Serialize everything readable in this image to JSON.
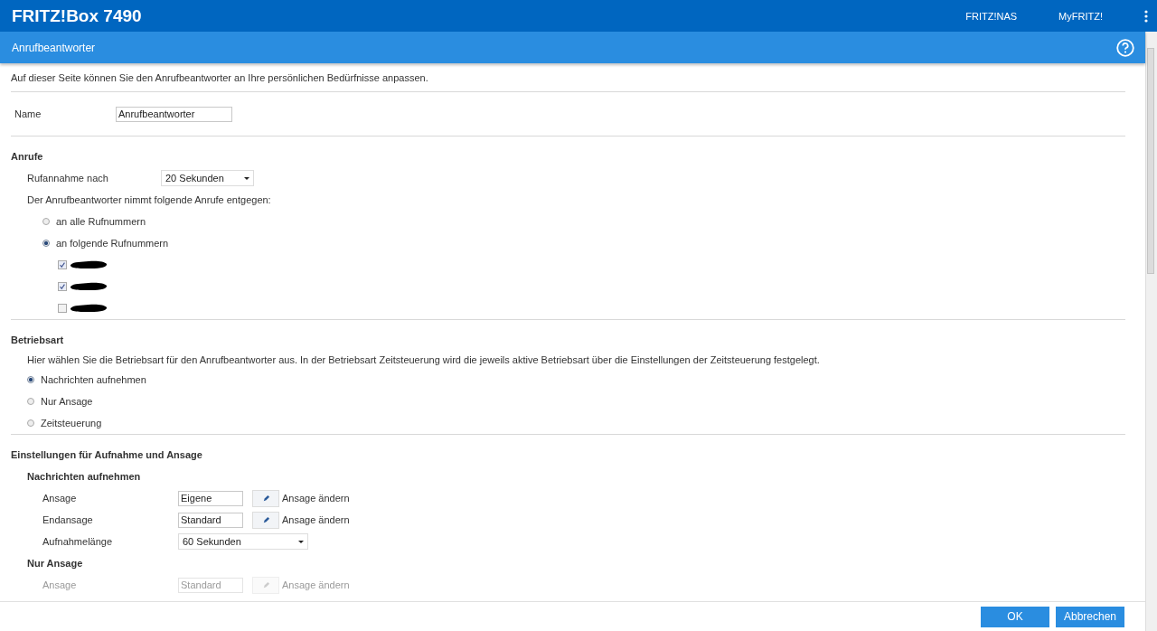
{
  "header": {
    "title": "FRITZ!Box 7490",
    "links": [
      "FRITZ!NAS",
      "MyFRITZ!"
    ]
  },
  "page": {
    "title": "Anrufbeantworter"
  },
  "intro": "Auf dieser Seite können Sie den Anrufbeantworter an Ihre persönlichen Bedürfnisse anpassen.",
  "name": {
    "label": "Name",
    "value": "Anrufbeantworter"
  },
  "calls": {
    "heading": "Anrufe",
    "pickup": {
      "label": "Rufannahme nach",
      "value": "20 Sekunden"
    },
    "prompt": "Der Anrufbeantworter nimmt folgende Anrufe entgegen:",
    "options": [
      {
        "label": "an alle Rufnummern",
        "selected": false
      },
      {
        "label": "an folgende Rufnummern",
        "selected": true
      }
    ],
    "numbers": [
      {
        "checked": true
      },
      {
        "checked": true
      },
      {
        "checked": false
      }
    ]
  },
  "mode": {
    "heading": "Betriebsart",
    "description": "Hier wählen Sie die Betriebsart für den Anrufbeantworter aus. In der Betriebsart Zeitsteuerung wird die jeweils aktive Betriebsart über die Einstellungen der Zeitsteuerung festgelegt.",
    "options": [
      {
        "label": "Nachrichten aufnehmen",
        "selected": true
      },
      {
        "label": "Nur Ansage",
        "selected": false
      },
      {
        "label": "Zeitsteuerung",
        "selected": false
      }
    ]
  },
  "settings": {
    "heading": "Einstellungen für Aufnahme und Ansage",
    "groups": [
      {
        "heading": "Nachrichten aufnehmen",
        "rows": [
          {
            "kind": "field",
            "label": "Ansage",
            "value": "Eigene",
            "action": "Ansage ändern",
            "disabled": false
          },
          {
            "kind": "field",
            "label": "Endansage",
            "value": "Standard",
            "action": "Ansage ändern",
            "disabled": false
          },
          {
            "kind": "select",
            "label": "Aufnahmelänge",
            "value": "60 Sekunden",
            "disabled": false
          }
        ]
      },
      {
        "heading": "Nur Ansage",
        "rows": [
          {
            "kind": "field",
            "label": "Ansage",
            "value": "Standard",
            "action": "Ansage ändern",
            "disabled": true
          }
        ]
      }
    ]
  },
  "buttons": [
    "OK",
    "Abbrechen"
  ]
}
